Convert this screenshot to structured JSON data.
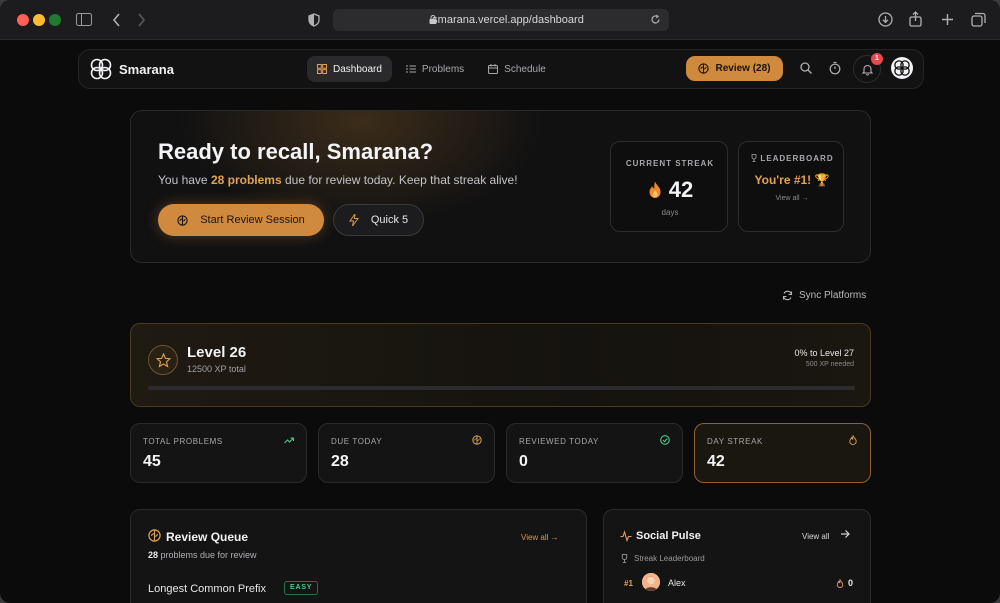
{
  "browser": {
    "url": "smarana.vercel.app/dashboard"
  },
  "navbar": {
    "brand": "Smarana",
    "tabs": [
      {
        "label": "Dashboard",
        "icon": "grid-icon",
        "active": true
      },
      {
        "label": "Problems",
        "icon": "list-icon",
        "active": false
      },
      {
        "label": "Schedule",
        "icon": "calendar-icon",
        "active": false
      }
    ],
    "review_button": "Review (28)",
    "notification_count": "1"
  },
  "hero": {
    "title": "Ready to recall, Smarana?",
    "sub_prefix": "You have ",
    "sub_highlight": "28 problems",
    "sub_suffix": " due for review today. Keep that streak alive!",
    "start_button": "Start Review Session",
    "quick_button": "Quick 5",
    "streak": {
      "label": "CURRENT STREAK",
      "value": "42",
      "unit": "days"
    },
    "leaderboard": {
      "label": "LEADERBOARD",
      "value": "You're #1! 🏆",
      "link": "View all →"
    }
  },
  "sync_label": "Sync Platforms",
  "level": {
    "title": "Level 26",
    "xp_total": "12500 XP total",
    "progress_label": "0% to Level 27",
    "needed": "500 XP needed",
    "progress_fraction": 0
  },
  "stats": [
    {
      "label": "TOTAL PROBLEMS",
      "value": "45",
      "icon": "trending-up-icon"
    },
    {
      "label": "DUE TODAY",
      "value": "28",
      "icon": "brain-icon"
    },
    {
      "label": "REVIEWED TODAY",
      "value": "0",
      "icon": "check-circle-icon"
    },
    {
      "label": "DAY STREAK",
      "value": "42",
      "icon": "flame-icon"
    }
  ],
  "queue": {
    "title": "Review Queue",
    "count": "28",
    "count_suffix": " problems due for review",
    "link": "View all →",
    "problem": {
      "name": "Longest Common Prefix",
      "difficulty": "EASY"
    }
  },
  "social": {
    "title": "Social Pulse",
    "link": "View all",
    "section": "Streak Leaderboard",
    "entry": {
      "rank": "#1",
      "name": "Alex",
      "score": "0"
    }
  },
  "colors": {
    "accent": "#d08a3e",
    "accent_text": "#e3a156",
    "easy": "#4ec98a",
    "background": "#0b0b0c"
  }
}
